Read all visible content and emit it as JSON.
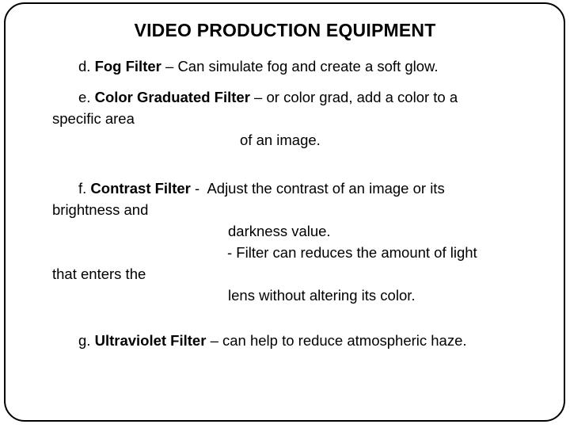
{
  "slide": {
    "title": "VIDEO PRODUCTION EQUIPMENT",
    "background_color": "#ffffff",
    "text_color": "#000000",
    "border_color": "#000000"
  },
  "items": {
    "d": {
      "letter": "d.",
      "term": "Fog Filter",
      "dash": "–",
      "definition": "Can simulate fog and create a soft glow."
    },
    "e": {
      "letter": "e.",
      "term": "Color Graduated Filter",
      "dash": "–",
      "definition_line1": "or color grad, add a color to a",
      "definition_line2": "specific area",
      "definition_line3": "of an image."
    },
    "f": {
      "letter": "f.",
      "term": "Contrast Filter",
      "dash": "-",
      "definition_line1": "Adjust the contrast of an image or its",
      "definition_line2": "brightness and",
      "definition_line3": "darkness value.",
      "definition_line4": "- Filter can reduces the amount of light",
      "definition_line5": "that enters the",
      "definition_line6": "lens without altering its color."
    },
    "g": {
      "letter": "g.",
      "term": "Ultraviolet Filter",
      "dash": "–",
      "definition": "can help to reduce atmospheric haze."
    }
  }
}
